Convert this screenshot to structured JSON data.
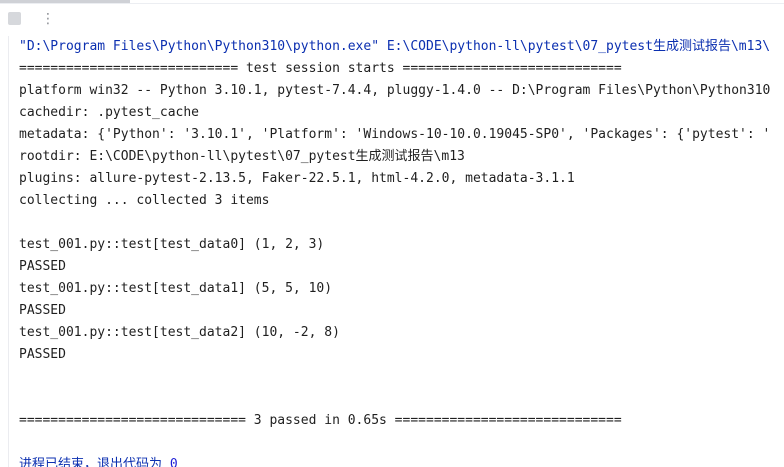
{
  "toolbar": {
    "stop_icon": "stop-icon",
    "more_icon": "more-vertical-icon",
    "more_glyph": "⋮"
  },
  "console": {
    "lines": [
      "\"D:\\Program Files\\Python\\Python310\\python.exe\" E:\\CODE\\python-ll\\pytest\\07_pytest生成测试报告\\m13\\",
      "============================ test session starts ============================",
      "platform win32 -- Python 3.10.1, pytest-7.4.4, pluggy-1.4.0 -- D:\\Program Files\\Python\\Python310",
      "cachedir: .pytest_cache",
      "metadata: {'Python': '3.10.1', 'Platform': 'Windows-10-10.0.19045-SP0', 'Packages': {'pytest': '",
      "rootdir: E:\\CODE\\python-ll\\pytest\\07_pytest生成测试报告\\m13",
      "plugins: allure-pytest-2.13.5, Faker-22.5.1, html-4.2.0, metadata-3.1.1",
      "collecting ... collected 3 items",
      "",
      "test_001.py::test[test_data0] (1, 2, 3)",
      "PASSED",
      "test_001.py::test[test_data1] (5, 5, 10)",
      "PASSED",
      "test_001.py::test[test_data2] (10, -2, 8)",
      "PASSED",
      "",
      "",
      "============================= 3 passed in 0.65s =============================",
      "",
      ""
    ],
    "exit_text": "进程已结束，退出代码为 ",
    "exit_code": "0"
  },
  "colors": {
    "command": "#0b2fb0",
    "text": "#1f1f1f",
    "background": "#ffffff"
  }
}
